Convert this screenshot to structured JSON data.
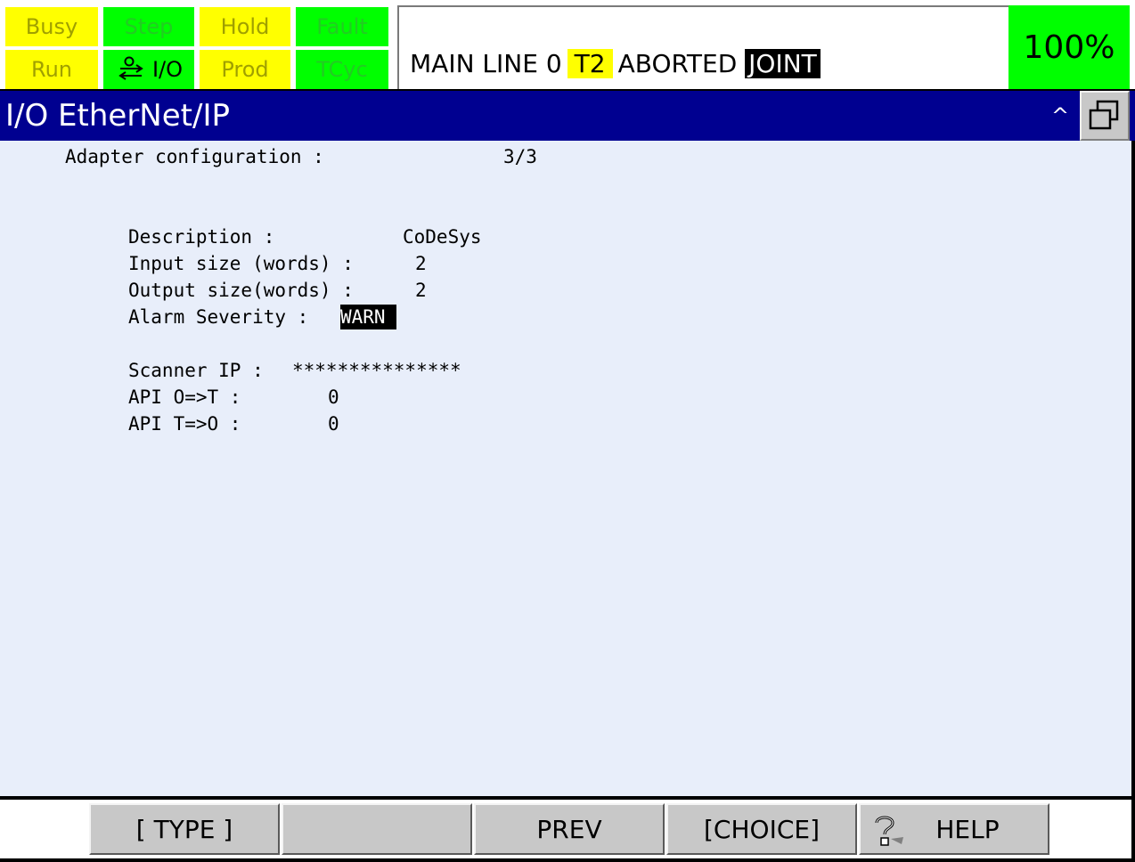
{
  "status_leds": {
    "busy": "Busy",
    "step": "Step",
    "hold": "Hold",
    "fault": "Fault",
    "run": "Run",
    "io": "I/O",
    "prod": "Prod",
    "tcyc": "TCyc"
  },
  "program_status": {
    "program": "MAIN",
    "line_label": "LINE",
    "line": "0",
    "mode": "T2",
    "state": "ABORTED",
    "coord": "JOINT"
  },
  "override": "100%",
  "title": "I/O EtherNet/IP",
  "title_caret": "^",
  "colors": {
    "led_yellow": "#ffff00",
    "led_green": "#00ff00",
    "title_bg": "#000090",
    "content_bg": "#e8eefa"
  },
  "adapter": {
    "label": "Adapter configuration :",
    "page": "3/3",
    "description_label": "Description :",
    "description_value": "CoDeSys",
    "input_size_label": "Input size (words) :",
    "input_size_value": "2",
    "output_size_label": "Output size(words) :",
    "output_size_value": "2",
    "alarm_label": "Alarm Severity :",
    "alarm_value": "WARN ",
    "scanner_ip_label": "Scanner IP :",
    "scanner_ip_value": "***************",
    "api_ot_label": "API O=>T :",
    "api_ot_value": "0",
    "api_to_label": "API T=>O :",
    "api_to_value": "0"
  },
  "fkeys": {
    "f1": "[ TYPE ]",
    "f2": "",
    "f3": "PREV",
    "f4": "[CHOICE]",
    "f5": "HELP"
  },
  "icons": {
    "io": "io-transfer-icon",
    "window": "restore-window-icon",
    "help": "help-icon"
  }
}
